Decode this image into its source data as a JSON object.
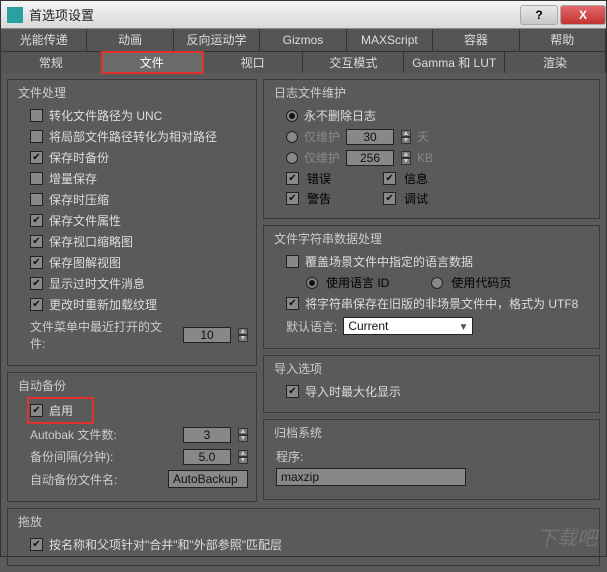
{
  "title": "首选项设置",
  "titlebar_buttons": {
    "help": "?",
    "close": "X"
  },
  "tabs_row1": [
    "光能传递",
    "动画",
    "反向运动学",
    "Gizmos",
    "MAXScript",
    "容器",
    "帮助"
  ],
  "tabs_row2": [
    "常规",
    "文件",
    "视口",
    "交互模式",
    "Gamma 和 LUT",
    "渲染"
  ],
  "active_tab_row2": 1,
  "left": {
    "file_handling": {
      "title": "文件处理",
      "items": [
        {
          "label": "转化文件路径为 UNC",
          "checked": false
        },
        {
          "label": "将局部文件路径转化为相对路径",
          "checked": false
        },
        {
          "label": "保存时备份",
          "checked": true
        },
        {
          "label": "增量保存",
          "checked": false
        },
        {
          "label": "保存时压缩",
          "checked": false
        },
        {
          "label": "保存文件属性",
          "checked": true
        },
        {
          "label": "保存视口缩略图",
          "checked": true
        },
        {
          "label": "保存图解视图",
          "checked": true
        },
        {
          "label": "显示过时文件消息",
          "checked": true
        },
        {
          "label": "更改时重新加载纹理",
          "checked": true
        }
      ],
      "recent_label": "文件菜单中最近打开的文件:",
      "recent_value": "10"
    },
    "autobackup": {
      "title": "自动备份",
      "enable_label": "启用",
      "enable_checked": true,
      "count_label": "Autobak 文件数:",
      "count_value": "3",
      "interval_label": "备份间隔(分钟):",
      "interval_value": "5.0",
      "name_label": "自动备份文件名:",
      "name_value": "AutoBackup"
    },
    "drag": {
      "title": "拖放",
      "item_label": "按名称和父项针对\"合并\"和\"外部参照\"匹配层",
      "checked": true
    }
  },
  "right": {
    "log": {
      "title": "日志文件维护",
      "opt1": "永不删除日志",
      "opt2": "仅维护",
      "opt2_value": "30",
      "opt2_unit": "天",
      "opt3": "仅维护",
      "opt3_value": "256",
      "opt3_unit": "KB",
      "selected": 0,
      "flags": [
        {
          "label": "错误",
          "checked": true
        },
        {
          "label": "信息",
          "checked": true
        },
        {
          "label": "警告",
          "checked": true
        },
        {
          "label": "调试",
          "checked": true
        }
      ]
    },
    "charset": {
      "title": "文件字符串数据处理",
      "override_label": "覆盖场景文件中指定的语言数据",
      "override_checked": false,
      "radio1": "使用语言 ID",
      "radio2": "使用代码页",
      "radio_selected": 0,
      "save_utf8_label": "将字符串保存在旧版的非场景文件中，格式为 UTF8",
      "save_utf8_checked": true,
      "default_lang_label": "默认语言:",
      "default_lang_value": "Current"
    },
    "import": {
      "title": "导入选项",
      "max_label": "导入时最大化显示",
      "max_checked": true
    },
    "archive": {
      "title": "归档系统",
      "program_label": "程序:",
      "program_value": "maxzip"
    }
  },
  "watermark": "下载吧"
}
